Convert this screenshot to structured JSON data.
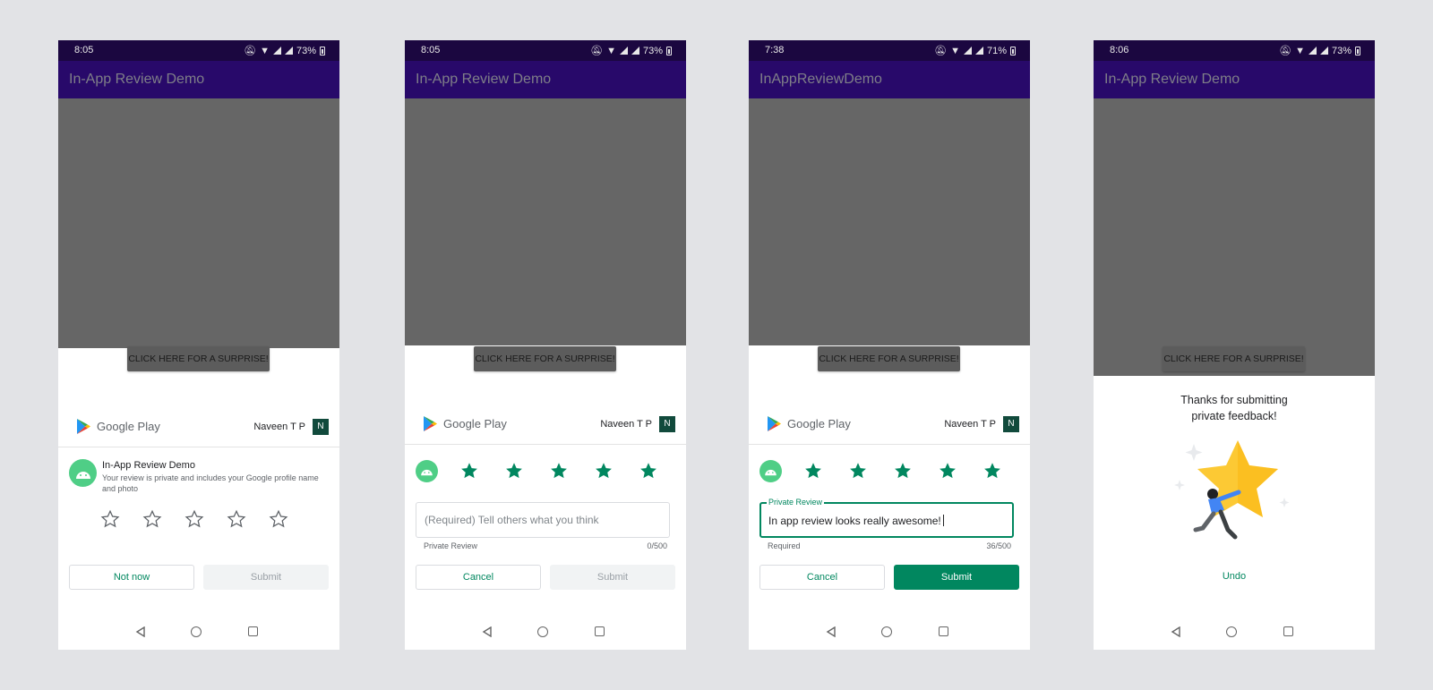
{
  "common": {
    "surprise_button": "CLICK HERE FOR A SURPRISE!",
    "google_play": "Google Play",
    "user_name": "Naveen T P",
    "user_initial": "N",
    "cancel": "Cancel",
    "submit": "Submit",
    "star_color": "#01875f",
    "accent": "#01875f",
    "appbar_color": "#28096a",
    "statusbar_color": "#1b0740"
  },
  "screens": [
    {
      "time": "8:05",
      "battery": "73%",
      "title": "In-App Review Demo",
      "app_name": "In-App Review Demo",
      "app_desc": "Your review is private and includes your Google profile name and photo",
      "not_now": "Not now",
      "rating": 0
    },
    {
      "time": "8:05",
      "battery": "73%",
      "title": "In-App Review Demo",
      "placeholder": "(Required) Tell others what you think",
      "helper_left": "Private Review",
      "helper_right": "0/500",
      "rating": 5
    },
    {
      "time": "7:38",
      "battery": "71%",
      "title": "InAppReviewDemo",
      "field_label": "Private Review",
      "field_value": "In app review looks really awesome!",
      "helper_left": "Required",
      "helper_right": "36/500",
      "rating": 5
    },
    {
      "time": "8:06",
      "battery": "73%",
      "title": "In-App Review Demo",
      "thanks_line1": "Thanks for submitting",
      "thanks_line2": "private feedback!",
      "undo": "Undo"
    }
  ]
}
